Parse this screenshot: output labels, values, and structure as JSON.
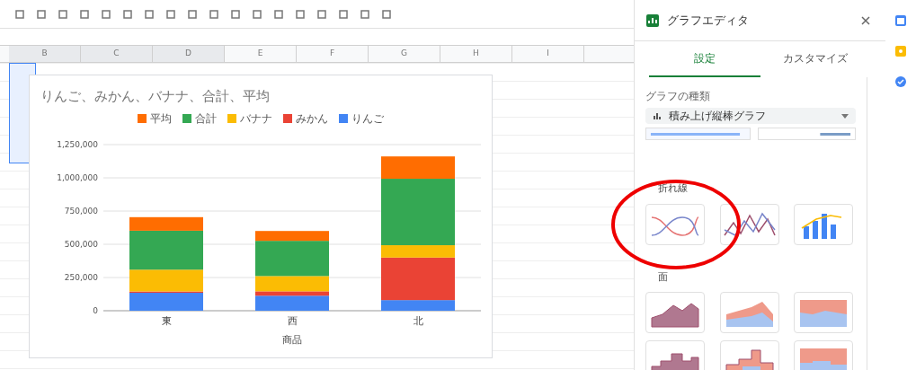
{
  "sheet": {
    "columns": [
      "B",
      "C",
      "D",
      "E",
      "F",
      "G",
      "H",
      "I"
    ]
  },
  "chart": {
    "title": "りんご、みかん、バナナ、合計、平均",
    "chart_data": {
      "type": "bar",
      "stacked": true,
      "xlabel": "商品",
      "categories": [
        "東",
        "西",
        "北"
      ],
      "series": [
        {
          "name": "りんご",
          "color": "#4285f4",
          "values": [
            135000,
            113000,
            80000
          ]
        },
        {
          "name": "みかん",
          "color": "#ea4335",
          "values": [
            10000,
            33000,
            320000
          ]
        },
        {
          "name": "バナナ",
          "color": "#fbbc04",
          "values": [
            164000,
            115000,
            93000
          ]
        },
        {
          "name": "合計",
          "color": "#34a853",
          "values": [
            293000,
            265000,
            500000
          ]
        },
        {
          "name": "平均",
          "color": "#ff6d01",
          "values": [
            102000,
            74000,
            168000
          ]
        }
      ],
      "grid": true,
      "ylim": [
        0,
        1250000
      ],
      "yticks": [
        {
          "value": 0,
          "label": "0"
        },
        {
          "value": 250000,
          "label": "250,000"
        },
        {
          "value": 500000,
          "label": "500,000"
        },
        {
          "value": 750000,
          "label": "750,000"
        },
        {
          "value": 1000000,
          "label": "1,000,000"
        },
        {
          "value": 1250000,
          "label": "1,250,000"
        }
      ]
    }
  },
  "editor": {
    "title": "グラフエディタ",
    "tabs": [
      {
        "label": "設定",
        "selected": true
      },
      {
        "label": "カスタマイズ",
        "selected": false
      }
    ],
    "chart_type_label": "グラフの種類",
    "chart_type_value": "積み上げ縦棒グラフ",
    "sections": [
      {
        "title": "折れ線",
        "items": [
          {
            "kind": "line"
          },
          {
            "kind": "smooth"
          },
          {
            "kind": "combo"
          }
        ]
      },
      {
        "title": "面",
        "items": [
          {
            "kind": "area"
          },
          {
            "kind": "stacked-area"
          },
          {
            "kind": "percent-area"
          },
          {
            "kind": "stepped-area"
          },
          {
            "kind": "stacked-stepped"
          },
          {
            "kind": "percent-stepped"
          }
        ]
      }
    ]
  },
  "annotation": {
    "kind": "circle"
  }
}
